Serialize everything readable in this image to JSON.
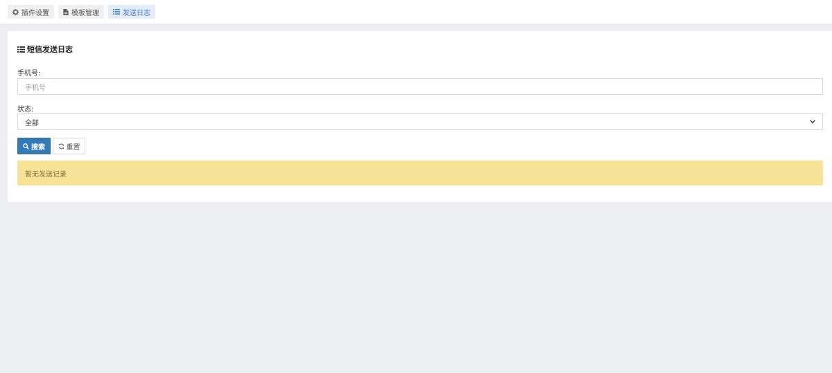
{
  "tabs": [
    {
      "label": "插件设置",
      "icon": "gear-icon"
    },
    {
      "label": "模板管理",
      "icon": "file-icon"
    },
    {
      "label": "发送日志",
      "icon": "list-icon",
      "active": true
    }
  ],
  "panel": {
    "title": "短信发送日志",
    "title_icon": "list-icon"
  },
  "form": {
    "phone_label": "手机号:",
    "phone_placeholder": "手机号",
    "status_label": "状态:",
    "status_selected": "全部",
    "search_button": "搜索",
    "reset_button": "重置"
  },
  "alert": {
    "message": "暂无发送记录"
  },
  "colors": {
    "primary": "#337ab7",
    "active_tab_text": "#3c7bd1",
    "alert_bg": "#f7e397",
    "alert_text": "#8a6d3b",
    "page_bg": "#eceef1"
  }
}
